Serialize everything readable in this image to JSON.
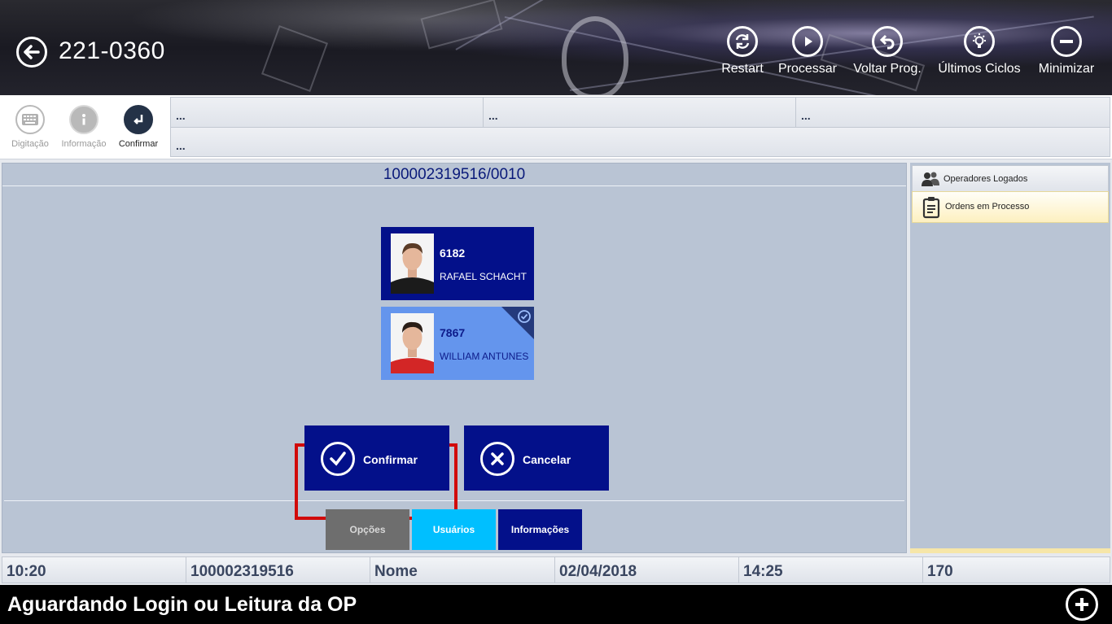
{
  "header": {
    "machine_id": "221-0360",
    "actions": [
      {
        "label": "Restart",
        "icon": "restart-icon"
      },
      {
        "label": "Processar",
        "icon": "play-icon"
      },
      {
        "label": "Voltar Prog.",
        "icon": "undo-icon"
      },
      {
        "label": "Últimos Ciclos",
        "icon": "lightbulb-icon"
      },
      {
        "label": "Minimizar",
        "icon": "minus-icon"
      }
    ]
  },
  "toolbar": {
    "buttons": [
      {
        "label": "Digitação",
        "icon": "keyboard-icon",
        "enabled": false
      },
      {
        "label": "Informação",
        "icon": "info-icon",
        "enabled": false
      },
      {
        "label": "Confirmar",
        "icon": "enter-icon",
        "enabled": true
      }
    ],
    "info_fields": [
      "...",
      "...",
      "...",
      "..."
    ]
  },
  "main": {
    "order_number": "100002319516/0010",
    "operators": [
      {
        "code": "6182",
        "name": "RAFAEL SCHACHT",
        "selected": false
      },
      {
        "code": "7867",
        "name": "WILLIAM ANTUNES",
        "selected": true
      }
    ],
    "confirm_label": "Confirmar",
    "cancel_label": "Cancelar",
    "tabs": [
      {
        "label": "Opções",
        "color": "#6e6e6e",
        "text_color": "#d8d8d8"
      },
      {
        "label": "Usuários",
        "color": "#00bfff",
        "text_color": "#ffffff"
      },
      {
        "label": "Informações",
        "color": "#03108a",
        "text_color": "#ffffff"
      }
    ]
  },
  "side": {
    "tabs": [
      {
        "label": "Operadores Logados",
        "icon": "users-icon",
        "active": false
      },
      {
        "label": "Ordens em Processo",
        "icon": "clipboard-icon",
        "active": true
      }
    ]
  },
  "status": {
    "time": "10:20",
    "order": "100002319516",
    "name": "Nome",
    "date": "02/04/2018",
    "time2": "14:25",
    "count": "170"
  },
  "footer": {
    "message": "Aguardando Login ou Leitura da OP"
  },
  "colors": {
    "button_blue": "#03108a",
    "selected_card": "#6495ed",
    "highlight_red": "#d10a0a",
    "panel_bg": "#b9c4d4"
  }
}
